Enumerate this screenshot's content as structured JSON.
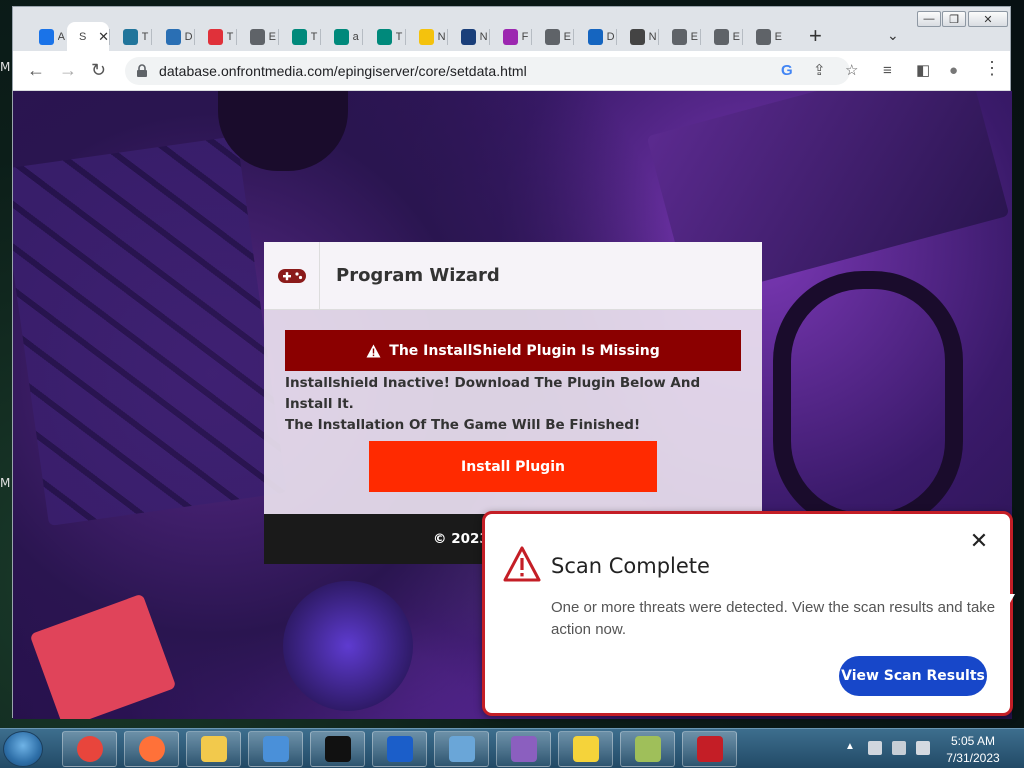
{
  "desktop": {
    "side_letters": [
      "M",
      "M"
    ]
  },
  "browser": {
    "tabs": [
      {
        "short": "A",
        "color": "#1a73e8",
        "icon": "spinner-icon"
      },
      {
        "short": "S",
        "color": "#ffffff",
        "icon": "blank-page-icon",
        "active": true
      },
      {
        "short": "T",
        "color": "#21759b",
        "icon": "wordpress-icon"
      },
      {
        "short": "D",
        "color": "#2a6fb4",
        "icon": "cloud-lock-icon"
      },
      {
        "short": "T",
        "color": "#e0313a",
        "icon": "opera-icon"
      },
      {
        "short": "E",
        "color": "#5f6368",
        "icon": "globe-icon"
      },
      {
        "short": "T",
        "color": "#00897b",
        "icon": "play-icon"
      },
      {
        "short": "a",
        "color": "#00897b",
        "icon": "play-icon"
      },
      {
        "short": "T",
        "color": "#00897b",
        "icon": "play-icon"
      },
      {
        "short": "N",
        "color": "#f4c20d",
        "icon": "checkmark-icon"
      },
      {
        "short": "N",
        "color": "#1a3f7a",
        "icon": "globe-icon"
      },
      {
        "short": "F",
        "color": "#9c27b0",
        "icon": "ai-icon"
      },
      {
        "short": "E",
        "color": "#5f6368",
        "icon": "globe-icon"
      },
      {
        "short": "D",
        "color": "#1565c0",
        "icon": "s-icon"
      },
      {
        "short": "N",
        "color": "#444444",
        "icon": "chrome-icon"
      },
      {
        "short": "E",
        "color": "#5f6368",
        "icon": "globe-icon"
      },
      {
        "short": "E",
        "color": "#5f6368",
        "icon": "globe-icon"
      },
      {
        "short": "E",
        "color": "#5f6368",
        "icon": "globe-icon"
      }
    ],
    "new_tab": "+",
    "tab_search": "⌄",
    "window_buttons": {
      "minimize": "—",
      "restore": "❐",
      "close": "✕"
    },
    "nav": {
      "back": "←",
      "forward": "→",
      "reload": "↻"
    },
    "url": "database.onfrontmedia.com/epingiserver/core/setdata.html",
    "toolbar_icons": {
      "google": "G",
      "share": "⇪",
      "bookmark": "☆",
      "reading_list": "≡",
      "sidepanel": "◧",
      "profile": "●",
      "menu": "⋮"
    }
  },
  "wizard": {
    "title": "Program Wizard",
    "alert": "The InstallShield Plugin Is Missing",
    "message_line1": "Installshield Inactive! Download The Plugin Below And Install It.",
    "message_line2": "The Installation Of The Game Will Be Finished!",
    "button": "Install Plugin",
    "footer": "© 2023"
  },
  "toast": {
    "title": "Scan Complete",
    "message": "One or more threats were detected. View the scan results and take action now.",
    "button": "View Scan Results",
    "close": "✕",
    "accent": "#c41e26",
    "button_color": "#1747c9"
  },
  "taskbar": {
    "items": [
      {
        "icon": "chrome-icon",
        "color": "#e8453c"
      },
      {
        "icon": "firefox-icon",
        "color": "#ff7139"
      },
      {
        "icon": "file-explorer-icon",
        "color": "#f2c94c"
      },
      {
        "icon": "security-shield-icon",
        "color": "#4a90d9"
      },
      {
        "icon": "command-prompt-icon",
        "color": "#111111"
      },
      {
        "icon": "malwarebytes-icon",
        "color": "#1b5ec9"
      },
      {
        "icon": "windows-security-icon",
        "color": "#6aa6d8"
      },
      {
        "icon": "installer-icon",
        "color": "#8b5fbf"
      },
      {
        "icon": "puzzle-icon",
        "color": "#f5d33a"
      },
      {
        "icon": "network-tool-icon",
        "color": "#9fbf5a"
      },
      {
        "icon": "recorder-icon",
        "color": "#c41e26"
      }
    ],
    "time": "5:05 AM",
    "date": "7/31/2023"
  }
}
